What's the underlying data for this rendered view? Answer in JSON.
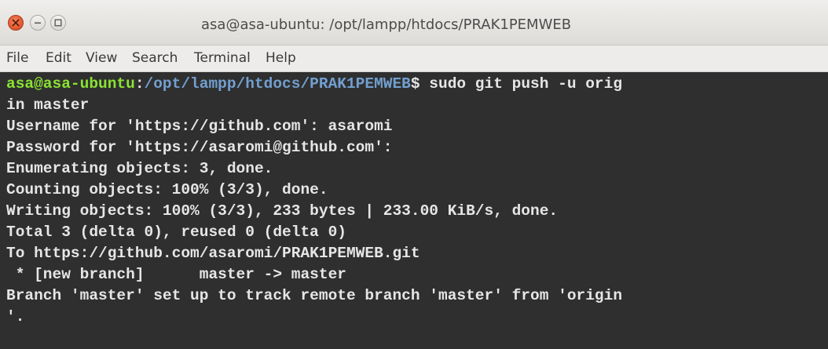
{
  "window": {
    "title": "asa@asa-ubuntu: /opt/lampp/htdocs/PRAK1PEMWEB",
    "buttons": {
      "close_icon": "close-icon",
      "minimize_icon": "minimize-icon",
      "maximize_icon": "maximize-icon"
    }
  },
  "menubar": {
    "items": [
      "File",
      "Edit",
      "View",
      "Search",
      "Terminal",
      "Help"
    ]
  },
  "terminal": {
    "prompt": {
      "user_host": "asa@asa-ubuntu",
      "separator": ":",
      "path": "/opt/lampp/htdocs/PRAK1PEMWEB",
      "symbol": "$",
      "command": " sudo git push -u orig"
    },
    "lines": [
      "in master",
      "Username for 'https://github.com': asaromi",
      "Password for 'https://asaromi@github.com':",
      "Enumerating objects: 3, done.",
      "Counting objects: 100% (3/3), done.",
      "Writing objects: 100% (3/3), 233 bytes | 233.00 KiB/s, done.",
      "Total 3 (delta 0), reused 0 (delta 0)",
      "To https://github.com/asaromi/PRAK1PEMWEB.git",
      " * [new branch]      master -> master",
      "Branch 'master' set up to track remote branch 'master' from 'origin",
      "'."
    ],
    "colors": {
      "background": "#2f2f2f",
      "text": "#e6e6e6",
      "user_host": "#8ae234",
      "path": "#729fcf"
    }
  }
}
